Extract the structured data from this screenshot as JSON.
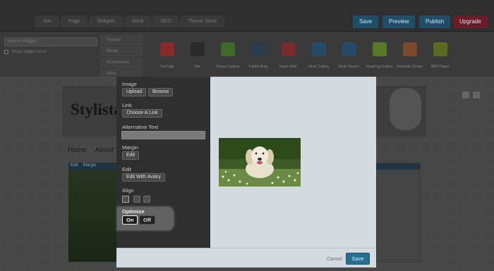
{
  "tabs": [
    "Site",
    "Page",
    "Widgets",
    "Store",
    "SEO",
    "Theme Store"
  ],
  "topbar": {
    "save": "Save",
    "preview": "Preview",
    "publish": "Publish",
    "upgrade": "Upgrade"
  },
  "widget_search": {
    "placeholder": "Search Widgets",
    "show_label": "Show widget icons"
  },
  "widget_categories": [
    "Popular",
    "Media",
    "Ecommerce",
    "More"
  ],
  "widget_apps": [
    {
      "label": "YouTube",
      "icon": "youtube-icon",
      "color": "#8a2b2b"
    },
    {
      "label": "File",
      "icon": "floppy-icon",
      "color": "#2b2b2b"
    },
    {
      "label": "Picture Gallery",
      "icon": "gallery-icon",
      "color": "#3f6a2a"
    },
    {
      "label": "Tumblr Blog",
      "icon": "tumblr-icon",
      "color": "#2a3a4f"
    },
    {
      "label": "Flash SWF",
      "icon": "flash-icon",
      "color": "#7a2b2b"
    },
    {
      "label": "Flickr Gallery",
      "icon": "flickr-icon",
      "color": "#244c6a"
    },
    {
      "label": "Flickr Search",
      "icon": "flickr-search-icon",
      "color": "#244c6a"
    },
    {
      "label": "ShopPop Gallery",
      "icon": "shoppop-icon",
      "color": "#587a24"
    },
    {
      "label": "Helmedia Ocean",
      "icon": "ocean-icon",
      "color": "#7a4a2a"
    },
    {
      "label": "MP3 Player",
      "icon": "music-note-icon",
      "color": "#5a6a1f"
    }
  ],
  "site": {
    "title": "Stylista",
    "nav": [
      "Home",
      "About"
    ],
    "photo_tool_edit": "Edit",
    "photo_tool_margin": "Margin"
  },
  "modal": {
    "image_label": "Image",
    "upload": "Upload",
    "browse": "Browse",
    "link_label": "Link",
    "choose_link": "Choose A Link",
    "alt_text_label": "Alternative Text",
    "alt_text_value": "",
    "margin_label": "Margin",
    "margin_edit": "Edit",
    "edit_label": "Edit",
    "edit_aviary": "Edit With Aviary",
    "align_label": "Align",
    "optimize_label": "Optimize",
    "on": "On",
    "off": "Off",
    "cancel": "Cancel",
    "save": "Save"
  }
}
